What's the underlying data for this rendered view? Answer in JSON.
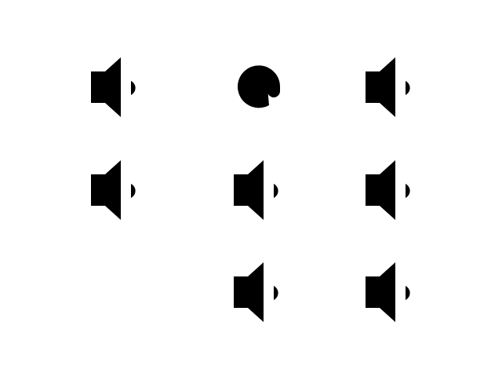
{
  "icon_grid": {
    "stroke_color": "#000000",
    "background_color": "#ffffff",
    "rows": [
      [
        "speaker-low-volume-icon",
        "at-sign-icon",
        "speaker-low-volume-icon"
      ],
      [
        "speaker-low-volume-icon",
        "speaker-low-volume-icon",
        "speaker-low-volume-icon"
      ],
      [
        "",
        "speaker-low-volume-icon",
        "speaker-low-volume-icon"
      ]
    ]
  }
}
